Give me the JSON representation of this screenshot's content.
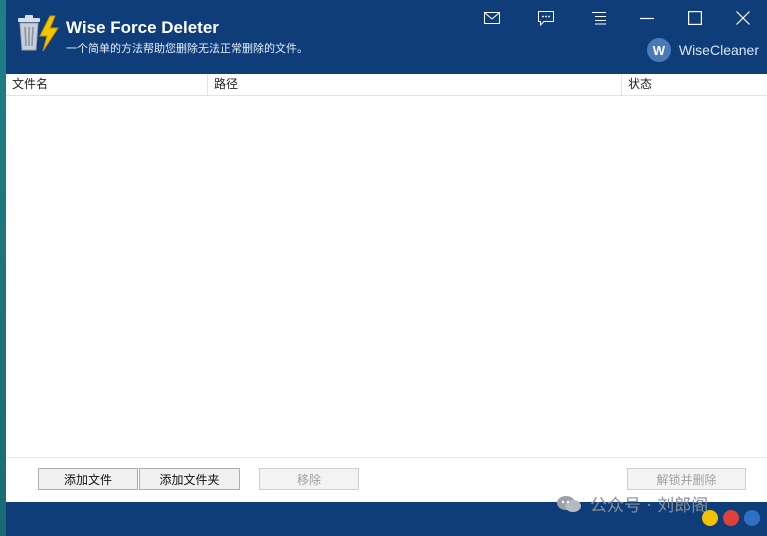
{
  "app": {
    "title": "Wise Force Deleter",
    "subtitle": "一个简单的方法帮助您删除无法正常删除的文件。",
    "brand_logo": "W",
    "brand_name": "WiseCleaner"
  },
  "titlebar_icons": [
    "mail-icon",
    "feedback-icon",
    "menu-icon",
    "minimize-icon",
    "maximize-icon",
    "close-icon"
  ],
  "table": {
    "columns": [
      {
        "label": "文件名"
      },
      {
        "label": "路径"
      },
      {
        "label": "状态"
      }
    ],
    "rows": []
  },
  "buttons": {
    "add_file": "添加文件",
    "add_folder": "添加文件夹",
    "remove": "移除",
    "unlock_delete": "解锁并删除"
  },
  "watermark": {
    "text": "公众号 · 刘郎阁"
  },
  "colors": {
    "titlebar": "#0e3d7a",
    "statusbar": "#0e3d7a",
    "desktop": "#1b6e7a"
  }
}
